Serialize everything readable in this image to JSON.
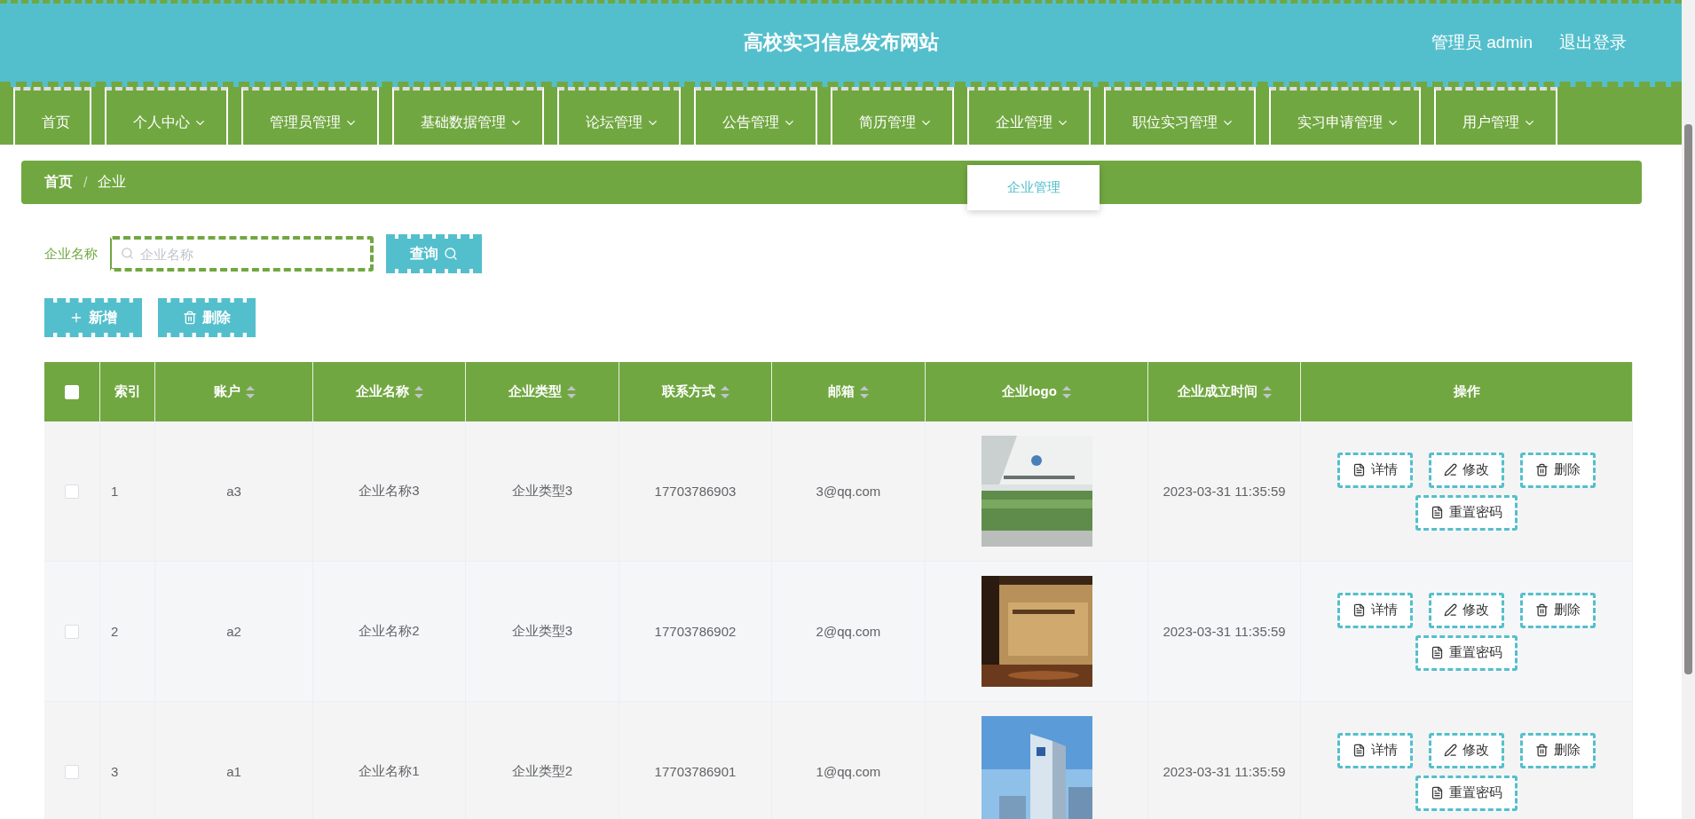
{
  "header": {
    "title": "高校实习信息发布网站",
    "user": "管理员 admin",
    "logout": "退出登录"
  },
  "nav": [
    {
      "label": "首页",
      "dropdown": false
    },
    {
      "label": "个人中心",
      "dropdown": true
    },
    {
      "label": "管理员管理",
      "dropdown": true
    },
    {
      "label": "基础数据管理",
      "dropdown": true
    },
    {
      "label": "论坛管理",
      "dropdown": true
    },
    {
      "label": "公告管理",
      "dropdown": true
    },
    {
      "label": "简历管理",
      "dropdown": true
    },
    {
      "label": "企业管理",
      "dropdown": true,
      "menu": [
        "企业管理"
      ]
    },
    {
      "label": "职位实习管理",
      "dropdown": true
    },
    {
      "label": "实习申请管理",
      "dropdown": true
    },
    {
      "label": "用户管理",
      "dropdown": true
    }
  ],
  "breadcrumb": {
    "items": [
      "首页",
      "企业"
    ],
    "separator": "/"
  },
  "search": {
    "label": "企业名称",
    "placeholder": "企业名称",
    "button": "查询"
  },
  "actions": [
    {
      "kind": "add",
      "label": "新增"
    },
    {
      "kind": "delete",
      "label": "删除"
    }
  ],
  "table": {
    "select_all": {
      "checked": false
    },
    "columns": [
      {
        "label": "索引",
        "sortable": false
      },
      {
        "label": "账户",
        "sortable": true
      },
      {
        "label": "企业名称",
        "sortable": true
      },
      {
        "label": "企业类型",
        "sortable": true
      },
      {
        "label": "联系方式",
        "sortable": true
      },
      {
        "label": "邮箱",
        "sortable": true
      },
      {
        "label": "企业logo",
        "sortable": true
      },
      {
        "label": "企业成立时间",
        "sortable": true
      },
      {
        "label": "操作",
        "sortable": false
      }
    ],
    "rows": [
      {
        "checked": false,
        "index": "1",
        "account": "a3",
        "name": "企业名称3",
        "type": "企业类型3",
        "phone": "17703786903",
        "email": "3@qq.com",
        "time": "2023-03-31 11:35:59",
        "buttons": [
          {
            "kind": "detail",
            "label": "详情"
          },
          {
            "kind": "edit",
            "label": "修改"
          },
          {
            "kind": "delete",
            "label": "删除"
          },
          {
            "kind": "reset",
            "label": "重置密码"
          }
        ]
      },
      {
        "checked": false,
        "index": "2",
        "account": "a2",
        "name": "企业名称2",
        "type": "企业类型3",
        "phone": "17703786902",
        "email": "2@qq.com",
        "time": "2023-03-31 11:35:59",
        "buttons": [
          {
            "kind": "detail",
            "label": "详情"
          },
          {
            "kind": "edit",
            "label": "修改"
          },
          {
            "kind": "delete",
            "label": "删除"
          },
          {
            "kind": "reset",
            "label": "重置密码"
          }
        ]
      },
      {
        "checked": false,
        "index": "3",
        "account": "a1",
        "name": "企业名称1",
        "type": "企业类型2",
        "phone": "17703786901",
        "email": "1@qq.com",
        "time": "2023-03-31 11:35:59",
        "buttons": [
          {
            "kind": "detail",
            "label": "详情"
          },
          {
            "kind": "edit",
            "label": "修改"
          },
          {
            "kind": "delete",
            "label": "删除"
          },
          {
            "kind": "reset",
            "label": "重置密码"
          }
        ]
      }
    ]
  }
}
